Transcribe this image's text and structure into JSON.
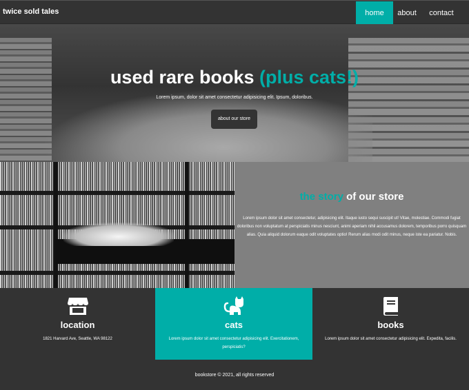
{
  "nav": {
    "brand": "twice sold tales",
    "links": [
      {
        "label": "home",
        "active": true
      },
      {
        "label": "about",
        "active": false
      },
      {
        "label": "contact",
        "active": false
      }
    ]
  },
  "hero": {
    "title_main": "used rare books ",
    "title_accent": "(plus cats!)",
    "subtitle": "Lorem ipsum, dolor sit amet consectetur adipisicing elit. Ipsum, doloribus.",
    "button": "about our store"
  },
  "story": {
    "title_accent": "the story",
    "title_rest": " of our store",
    "body": "Lorem ipsum dolor sit amet consectetur, adipisicing elit. Itaque iusto sequi suscipit ut! Vitae, molestiae. Commodi fugiat doloribus non voluptatum at perspiciatis minus nesciunt, animi aperiam nihil accusamus dolorem, temporibus porro quisquam alias. Quia aliquid dolorum eaque odit voluptates optio! Rerum alias modi odit minus, neque iste ea pariatur. Nobis."
  },
  "features": [
    {
      "icon": "store-icon",
      "title": "location",
      "text": "1821 Harvard Ave, Seattle, WA 98122"
    },
    {
      "icon": "cat-icon",
      "title": "cats",
      "text": "Lorem ipsum dolor sit amet consectetur adipisicing elit. Exercitationem, perspiciatis?"
    },
    {
      "icon": "book-icon",
      "title": "books",
      "text": "Lorem ipsum dolor sit amet consectetur adipisicing elit. Expedita, facilis."
    }
  ],
  "footer": {
    "text": "bookstore © 2021, all rights reserved"
  },
  "colors": {
    "accent": "#00aea8",
    "dark": "#333333",
    "gray_panel": "#808080"
  }
}
